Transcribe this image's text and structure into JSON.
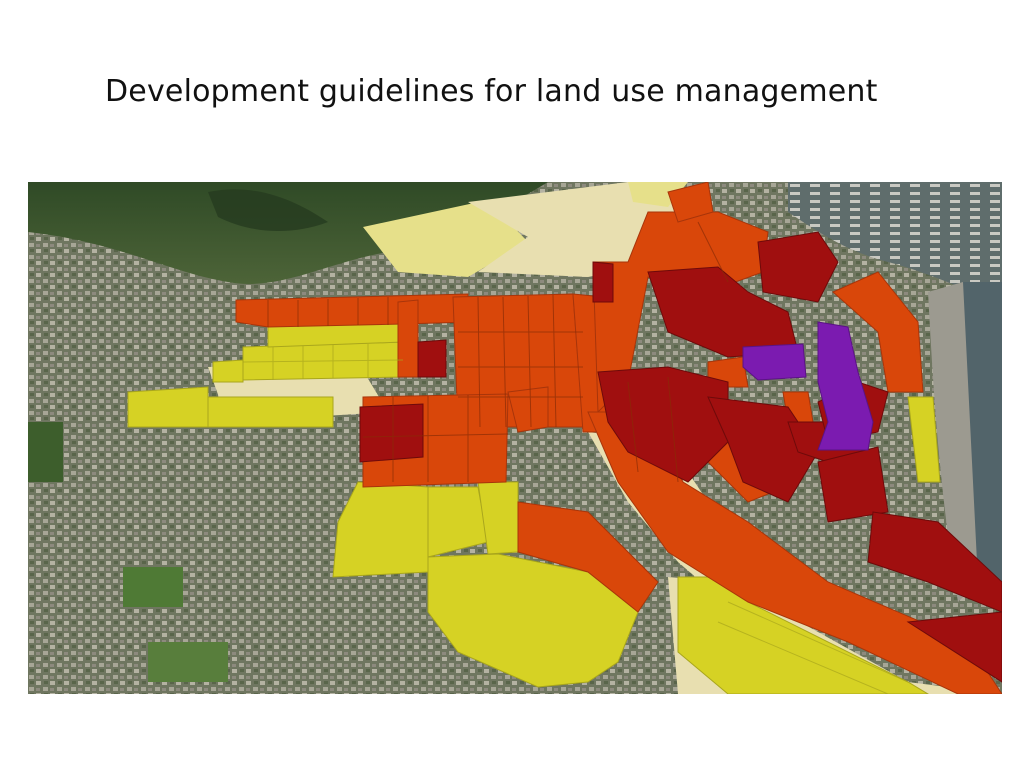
{
  "slide": {
    "title": "Development guidelines for land use management"
  },
  "map": {
    "colors": {
      "yellow": "#d6d224",
      "orange": "#d9470a",
      "red": "#a00f0f",
      "purple": "#7b1bb0",
      "beige": "#e8dfb0"
    }
  }
}
